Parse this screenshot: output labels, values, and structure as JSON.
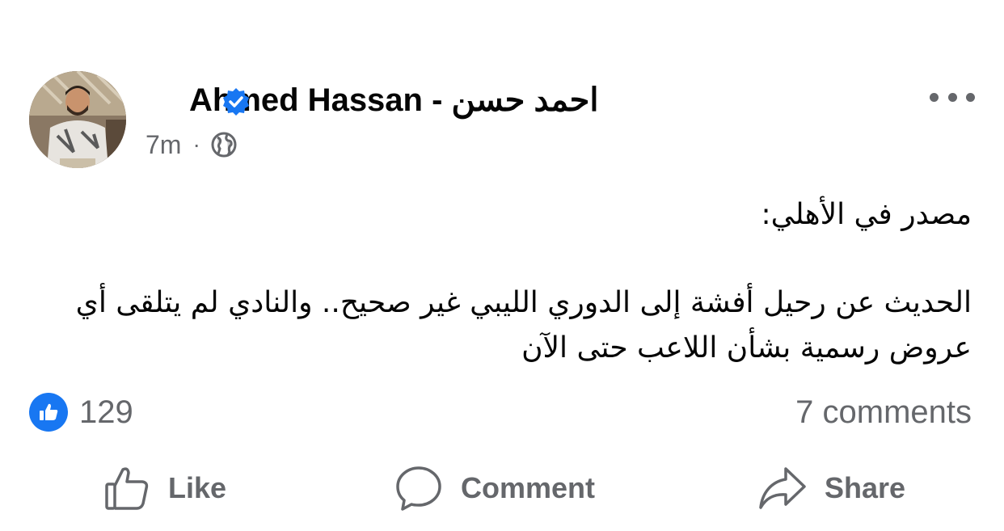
{
  "post": {
    "author": "Ahmed Hassan - احمد حسن",
    "time": "7m",
    "separator": "·",
    "body_line1": "مصدر في الأهلي:",
    "body_line2": "الحديث عن رحيل أفشة إلى الدوري الليبي غير صحيح.. والنادي لم يتلقى أي عروض رسمية بشأن اللاعب حتى الآن"
  },
  "engagement": {
    "likes": "129",
    "comments": "7 comments"
  },
  "actions": {
    "like": "Like",
    "comment": "Comment",
    "share": "Share"
  },
  "icons": {
    "verified": "verified-badge-icon",
    "audience": "globe-icon",
    "menu": "more-options-icon",
    "like": "thumbs-up-icon",
    "comment": "speech-bubble-icon",
    "share": "share-arrow-icon"
  },
  "colors": {
    "accent": "#1877f2",
    "secondary_text": "#65676b",
    "primary_text": "#050505"
  }
}
